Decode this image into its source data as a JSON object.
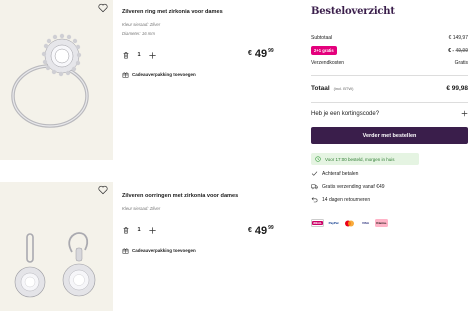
{
  "cart": {
    "items": [
      {
        "title": "Zilveren ring met zirkonia voor dames",
        "meta1": "Kleur sieraad: Zilver",
        "meta2": "Diameter: 16 mm",
        "quantity": "1",
        "currency": "€",
        "price_int": "49",
        "price_dec": "99",
        "gift_label": "Cadeauverpakking toevoegen"
      },
      {
        "title": "Zilveren oorringen met zirkonia voor dames",
        "meta1": "Kleur sieraad: Zilver",
        "quantity": "1",
        "currency": "€",
        "price_int": "49",
        "price_dec": "99",
        "gift_label": "Cadeauverpakking toevoegen"
      }
    ]
  },
  "summary": {
    "title": "Besteloverzicht",
    "subtotal_label": "Subtotaal",
    "subtotal_value": "€ 149,97",
    "promo_badge": "2+1 gratis",
    "promo_value_prefix": "€ -",
    "promo_value": "49,99",
    "shipping_label": "Verzendkosten",
    "shipping_value": "Gratis",
    "total_label": "Totaal",
    "total_incl": "(incl. BTW)",
    "total_value": "€ 99,98",
    "discount_label": "Heb je een kortingscode?",
    "cta_label": "Verder met bestellen",
    "delivery_note": "Voor 17:00 besteld, morgen in huis",
    "usps": [
      "Achteraf betalen",
      "Gratis verzending vanaf €49",
      "14 dagen retourneren"
    ],
    "payment_methods": [
      {
        "name": "iDEAL",
        "label": "iDEAL",
        "bg": "#ffffff",
        "fg": "#cc0066"
      },
      {
        "name": "PayPal",
        "label": "PayPal",
        "bg": "#ffffff",
        "fg": "#003087"
      },
      {
        "name": "Mastercard",
        "label": "",
        "bg": "#ffffff",
        "fg": "#eb001b"
      },
      {
        "name": "Visa",
        "label": "VISA",
        "bg": "#ffffff",
        "fg": "#1a1f71"
      },
      {
        "name": "Klarna",
        "label": "Klarna.",
        "bg": "#ffb3c7",
        "fg": "#17120f"
      }
    ]
  },
  "colors": {
    "brand_purple": "#3a1e4b",
    "promo_pink": "#e4007c",
    "free_green": "#2f9a36",
    "image_bg": "#f4f2ea"
  }
}
